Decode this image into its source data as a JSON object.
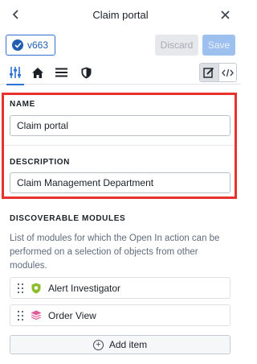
{
  "header": {
    "title": "Claim portal",
    "back_icon": "chevron-left-icon",
    "close_icon": "close-icon"
  },
  "toolbar": {
    "version_label": "v663",
    "discard_label": "Discard",
    "save_label": "Save"
  },
  "tabs": [
    {
      "icon": "sliders-icon",
      "active": true
    },
    {
      "icon": "home-icon",
      "active": false
    },
    {
      "icon": "list-icon",
      "active": false
    },
    {
      "icon": "shield-icon",
      "active": false
    }
  ],
  "view_toggle": [
    {
      "icon": "edit-icon",
      "active": true
    },
    {
      "icon": "code-icon",
      "active": false
    }
  ],
  "name": {
    "label": "NAME",
    "value": "Claim portal"
  },
  "description": {
    "label": "DESCRIPTION",
    "value": "Claim Management Department"
  },
  "discoverable": {
    "label": "DISCOVERABLE MODULES",
    "help_text": "List of modules for which the Open In action can be performed on a selection of objects from other modules.",
    "modules": [
      {
        "label": "Alert Investigator",
        "icon": "shield-badge-icon",
        "color": "#8bbd2c"
      },
      {
        "label": "Order View",
        "icon": "layers-icon",
        "color": "#e05a97"
      }
    ],
    "add_label": "Add item"
  },
  "colors": {
    "accent": "#2d72d2",
    "highlight_border": "#e8312b"
  }
}
